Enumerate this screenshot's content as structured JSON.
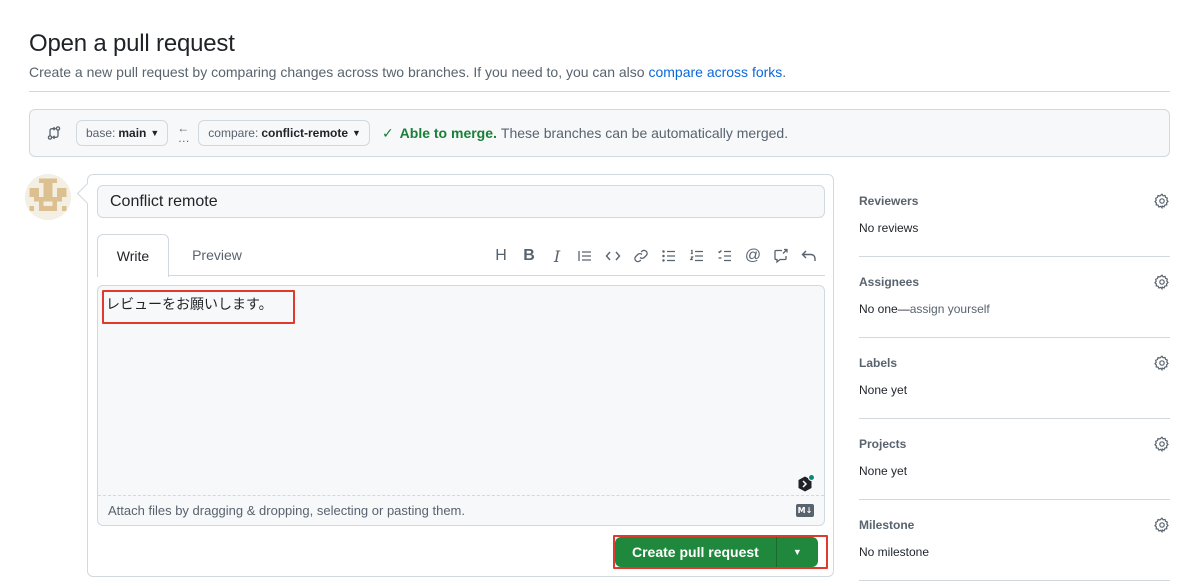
{
  "header": {
    "title": "Open a pull request",
    "subtitle": "Create a new pull request by comparing changes across two branches. If you need to, you can also ",
    "compare_forks_link": "compare across forks",
    "subtitle_end": "."
  },
  "range": {
    "base_label": "base:",
    "base_branch": "main",
    "compare_label": "compare:",
    "compare_branch": "conflict-remote",
    "merge_ok": "Able to merge.",
    "merge_msg": "These branches can be automatically merged."
  },
  "form": {
    "title_value": "Conflict remote",
    "tabs": [
      {
        "label": "Write",
        "active": true
      },
      {
        "label": "Preview",
        "active": false
      }
    ],
    "toolbar_icons": [
      "heading-icon",
      "bold-icon",
      "italic-icon",
      "quote-icon",
      "code-icon",
      "link-icon",
      "unordered-list-icon",
      "ordered-list-icon",
      "task-list-icon",
      "mention-icon",
      "cross-reference-icon",
      "undo-icon"
    ],
    "body_value": "レビューをお願いします。",
    "attach_hint": "Attach files by dragging & dropping, selecting or pasting them.",
    "markdown_badge": "M↓",
    "create_label": "Create pull request"
  },
  "sidebar": {
    "sections": [
      {
        "title": "Reviewers",
        "value": "No reviews"
      },
      {
        "title": "Assignees",
        "value_prefix": "No one—",
        "value_link": "assign yourself"
      },
      {
        "title": "Labels",
        "value": "None yet"
      },
      {
        "title": "Projects",
        "value": "None yet"
      },
      {
        "title": "Milestone",
        "value": "No milestone"
      }
    ]
  },
  "colors": {
    "accent_green": "#1f883d",
    "link_blue": "#0969da",
    "highlight_red": "#e03a2f",
    "merge_green": "#1a7f37"
  }
}
